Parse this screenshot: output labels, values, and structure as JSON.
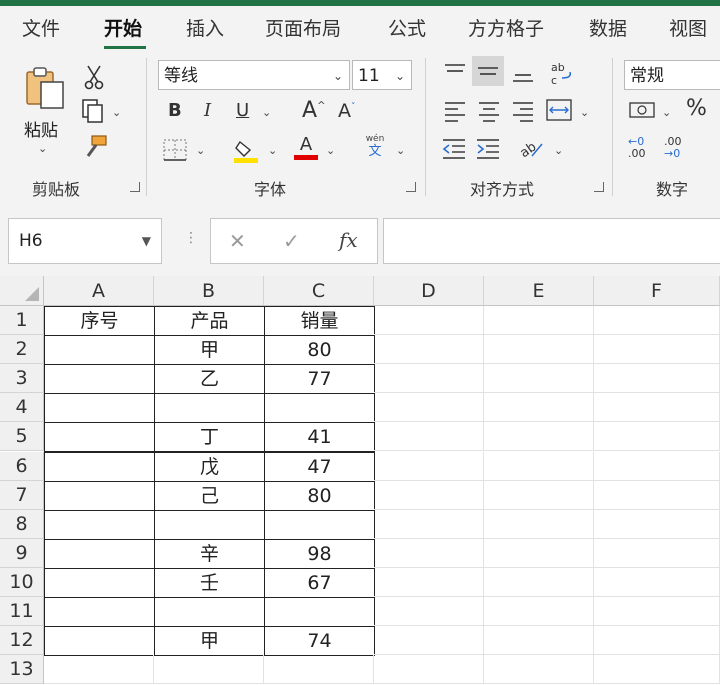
{
  "tabs": [
    "文件",
    "开始",
    "插入",
    "页面布局",
    "公式",
    "方方格子",
    "数据",
    "视图"
  ],
  "ribbon": {
    "clipboard": {
      "paste_label": "粘贴",
      "group_label": "剪贴板"
    },
    "font": {
      "name": "等线",
      "size": "11",
      "group_label": "字体",
      "phonetic_top": "wén",
      "phonetic_bottom": "文"
    },
    "alignment": {
      "group_label": "对齐方式"
    },
    "number": {
      "format": "常规",
      "group_label": "数字"
    }
  },
  "colors": {
    "accent": "#217346",
    "fill_color": "#ffe000",
    "font_color": "#e00000"
  },
  "formula_bar": {
    "name_box": "H6",
    "fx": "fx",
    "value": ""
  },
  "sheet": {
    "columns": [
      "A",
      "B",
      "C",
      "D",
      "E",
      "F"
    ],
    "rows": [
      "1",
      "2",
      "3",
      "4",
      "5",
      "6",
      "7",
      "8",
      "9",
      "10",
      "11",
      "12",
      "13"
    ],
    "cells": [
      [
        "序号",
        "产品",
        "销量"
      ],
      [
        "",
        "甲",
        "80"
      ],
      [
        "",
        "乙",
        "77"
      ],
      [
        "",
        "",
        ""
      ],
      [
        "",
        "丁",
        "41"
      ],
      [
        "",
        "戊",
        "47"
      ],
      [
        "",
        "己",
        "80"
      ],
      [
        "",
        "",
        ""
      ],
      [
        "",
        "辛",
        "98"
      ],
      [
        "",
        "壬",
        "67"
      ],
      [
        "",
        "",
        ""
      ],
      [
        "",
        "甲",
        "74"
      ]
    ]
  }
}
